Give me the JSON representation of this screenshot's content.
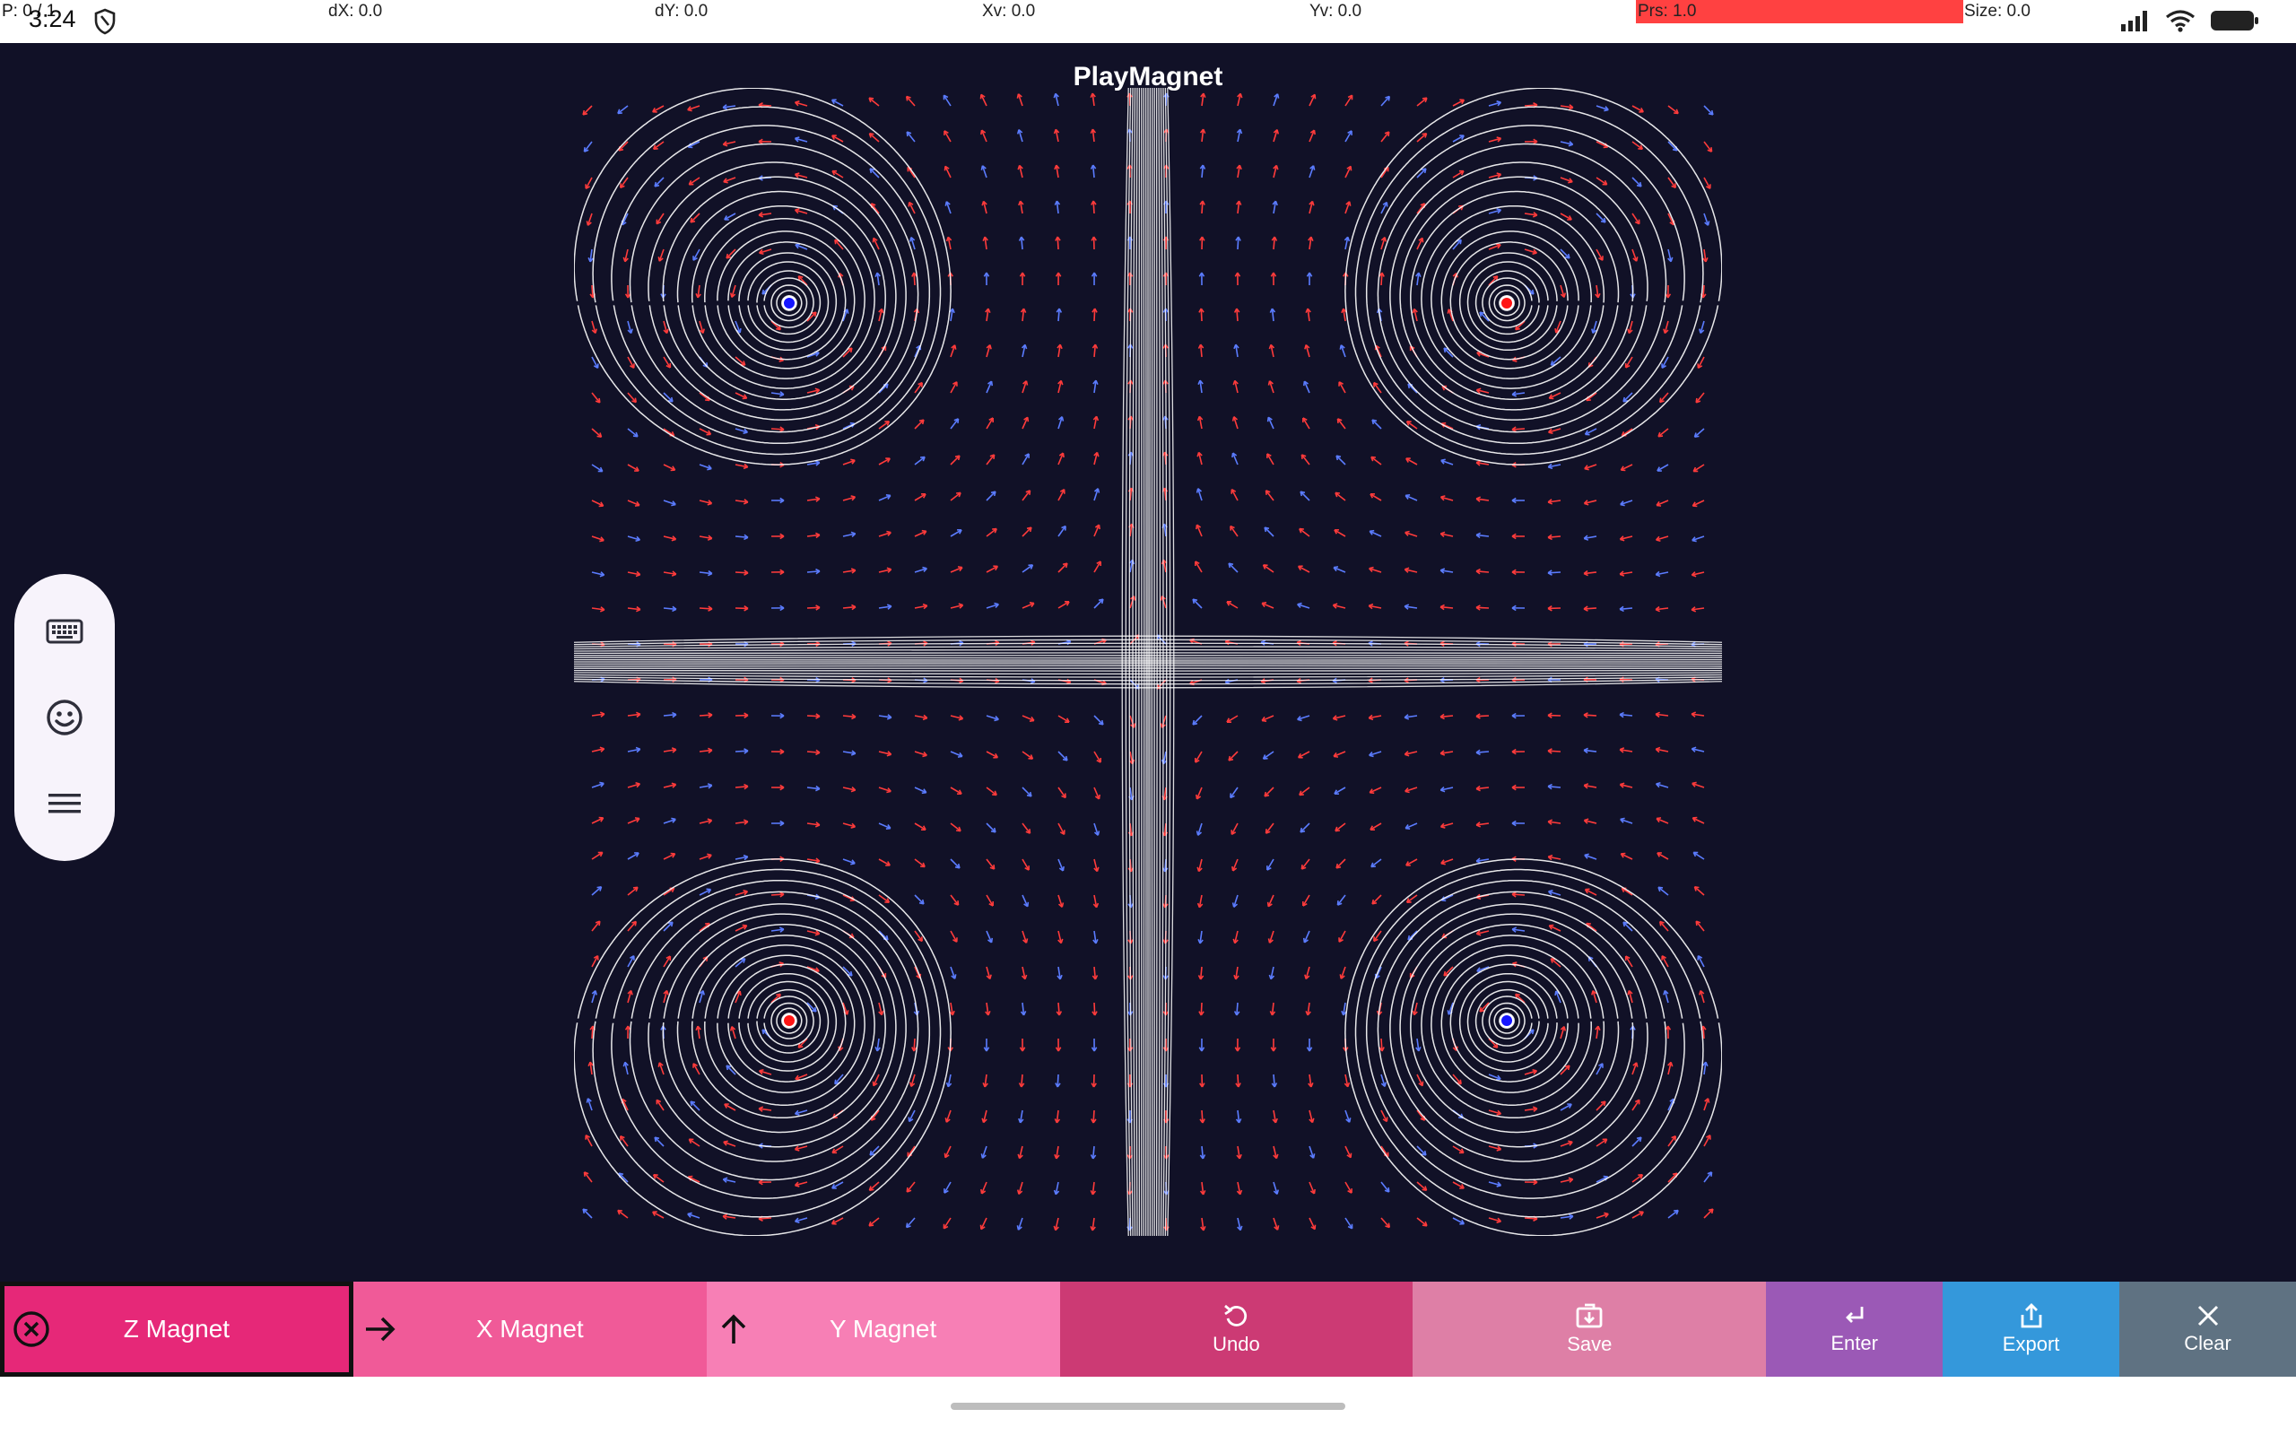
{
  "status_bar": {
    "time": "3:24",
    "pointer": "P: 0 / 1",
    "dx": "dX: 0.0",
    "dy": "dY: 0.0",
    "xv": "Xv: 0.0",
    "yv": "Yv: 0.0",
    "prs": "Prs: 1.0",
    "size": "Size: 0.0",
    "prs_bar_color": "#ff4141",
    "icons": [
      "shield-icon",
      "signal-icon",
      "wifi-icon",
      "battery-icon"
    ]
  },
  "app": {
    "title": "PlayMagnet",
    "background": "#111127"
  },
  "field": {
    "magnets": [
      {
        "pole": "north",
        "color": "#1515ff",
        "x": -1,
        "y": 1
      },
      {
        "pole": "south",
        "color": "#ff1515",
        "x": 1,
        "y": 1
      },
      {
        "pole": "south",
        "color": "#ff1515",
        "x": -1,
        "y": -1
      },
      {
        "pole": "north",
        "color": "#1515ff",
        "x": 1,
        "y": -1
      }
    ],
    "line_color": "#ffffff",
    "arrow_colors": [
      "#ff3b3b",
      "#5b7cff"
    ]
  },
  "side_toolbar": {
    "items": [
      {
        "name": "keyboard",
        "icon": "keyboard-icon"
      },
      {
        "name": "emoji",
        "icon": "emoji-icon"
      },
      {
        "name": "menu",
        "icon": "menu-icon"
      }
    ]
  },
  "toolbar": {
    "z_magnet": {
      "label": "Z Magnet",
      "icon": "circle-x-icon",
      "color": "#e62878"
    },
    "x_magnet": {
      "label": "X Magnet",
      "icon": "arrow-right-icon",
      "color": "#f05a98"
    },
    "y_magnet": {
      "label": "Y Magnet",
      "icon": "arrow-up-icon",
      "color": "#f77fb5"
    },
    "undo": {
      "label": "Undo",
      "icon": "undo-icon",
      "color": "#cc3a74"
    },
    "save": {
      "label": "Save",
      "icon": "save-icon",
      "color": "#de7fa6"
    },
    "enter": {
      "label": "Enter",
      "icon": "enter-icon",
      "color": "#9b59b6"
    },
    "export": {
      "label": "Export",
      "icon": "export-icon",
      "color": "#3498db"
    },
    "clear": {
      "label": "Clear",
      "icon": "close-icon",
      "color": "#5f7282"
    }
  }
}
